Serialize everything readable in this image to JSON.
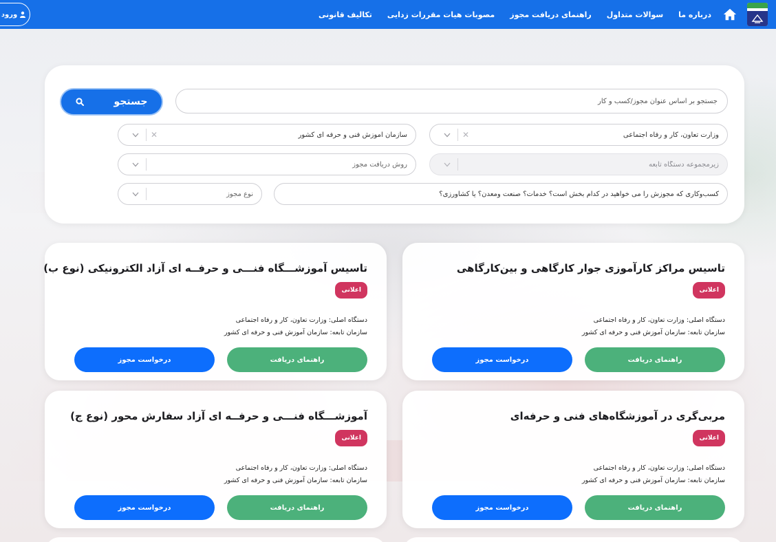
{
  "header": {
    "nav": [
      "درباره ما",
      "سوالات متداول",
      "راهنمای دریافت مجوز",
      "مصوبات هیات مقررات زدایی",
      "تکالیف قانونی"
    ],
    "login_label": "ورود"
  },
  "search": {
    "placeholder": "جستجو بر اساس عنوان مجوز/کسب و کار",
    "button_label": "جستجو",
    "ministry": "وزارت تعاون، کار و رفاه اجتماعی",
    "organization": "سازمان آموزش فنی و حرفه ای کشور",
    "sub_org_placeholder": "زیرمجموعه دستگاه تابعه",
    "method_placeholder": "روش دریافت مجوز",
    "sector_placeholder": "کسب‌وکاری که مجوزش را می خواهید در کدام بخش است؟ خدمات؟ صنعت ومعدن؟ یا کشاورزی؟",
    "type_placeholder": "نوع مجوز"
  },
  "cards": [
    {
      "title": "تاسیس مراکز کارآموزی جوار کارگاهی و بین‌کارگاهی",
      "badge": "اعلانی",
      "main_org": "دستگاه اصلی: وزارت تعاون، کار و رفاه اجتماعی",
      "sub_org": "سازمان تابعه: سازمان آموزش فنی و حرفه ای کشور",
      "guide_label": "راهنمای دریافت",
      "request_label": "درخواست مجوز"
    },
    {
      "title": "تاسیس آموزشـــگاه فنـــی و حرفــه ای آزاد الکترونیکی (نوع ب)",
      "badge": "اعلانی",
      "main_org": "دستگاه اصلی: وزارت تعاون، کار و رفاه اجتماعی",
      "sub_org": "سازمان تابعه: سازمان آموزش فنی و حرفه ای کشور",
      "guide_label": "راهنمای دریافت",
      "request_label": "درخواست مجوز"
    },
    {
      "title": "مربی‌گری در آموزشگاه‌های فنی و حرفه‌ای",
      "badge": "اعلانی",
      "main_org": "دستگاه اصلی: وزارت تعاون، کار و رفاه اجتماعی",
      "sub_org": "سازمان تابعه: سازمان آموزش فنی و حرفه ای کشور",
      "guide_label": "راهنمای دریافت",
      "request_label": "درخواست مجوز"
    },
    {
      "title": "آموزشـــگاه فنـــی و حرفــه ای آزاد سفارش محور (نوع ج)",
      "badge": "اعلانی",
      "main_org": "دستگاه اصلی: وزارت تعاون، کار و رفاه اجتماعی",
      "sub_org": "سازمان تابعه: سازمان آموزش فنی و حرفه ای کشور",
      "guide_label": "راهنمای دریافت",
      "request_label": "درخواست مجوز"
    }
  ],
  "colors": {
    "primary": "#1670e8",
    "guide_button": "#4cb17b",
    "request_button": "#0d6efd",
    "badge": "#d0355f"
  }
}
